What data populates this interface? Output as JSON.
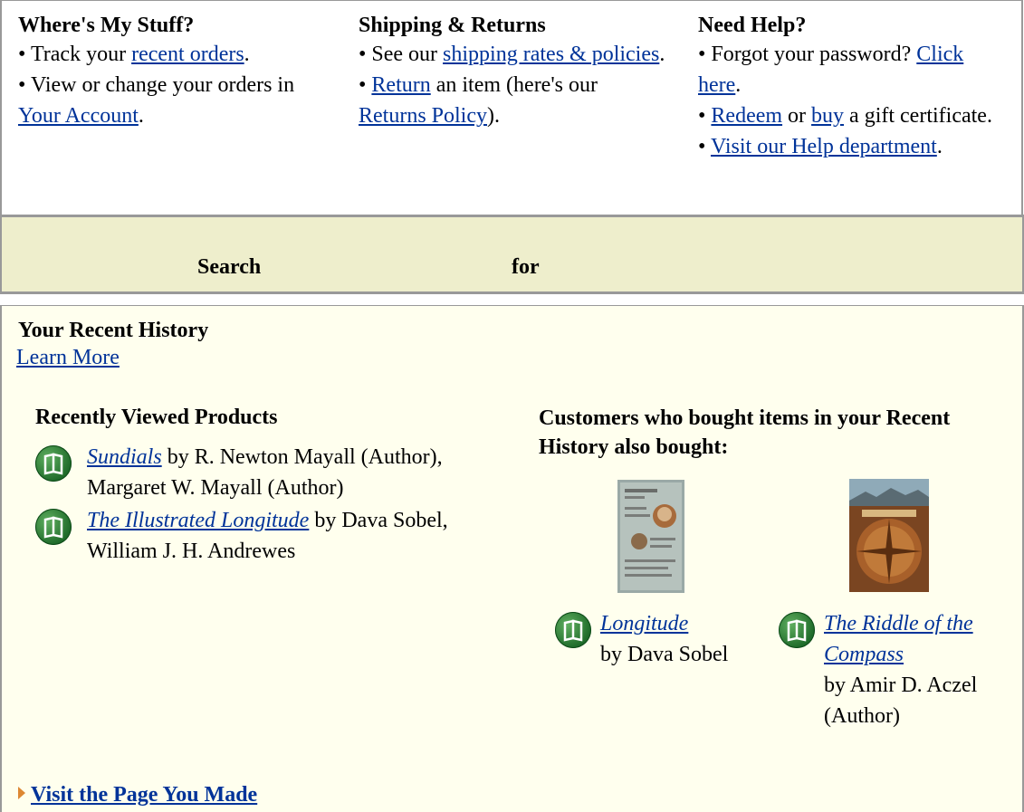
{
  "help": {
    "col1": {
      "title": "Where's My Stuff?",
      "l1_pre": "• Track your ",
      "l1_link": "recent orders",
      "l1_post": ".",
      "l2_pre": "• View or change your orders in ",
      "l2_link": "Your Account",
      "l2_post": "."
    },
    "col2": {
      "title": "Shipping & Returns",
      "l1_pre": "• See our ",
      "l1_link": "shipping rates & policies",
      "l1_post": ".",
      "l2_pre": "• ",
      "l2_link": "Return",
      "l2_mid": " an item (here's our ",
      "l2_link2": "Returns Policy",
      "l2_post": ")."
    },
    "col3": {
      "title": "Need Help?",
      "l1_pre": "• Forgot your password? ",
      "l1_link": "Click here",
      "l1_post": ".",
      "l2_pre": "• ",
      "l2_link": "Redeem",
      "l2_mid": " or ",
      "l2_link2": "buy",
      "l2_post": " a gift certificate.",
      "l3_pre": "• ",
      "l3_link": "Visit our Help department",
      "l3_post": "."
    }
  },
  "search": {
    "label": "Search",
    "for_label": "for"
  },
  "history": {
    "title": "Your Recent History",
    "learn_more": "Learn More",
    "recently_viewed": {
      "title": "Recently Viewed Products",
      "items": [
        {
          "title": "Sundials",
          "byline": " by R. Newton Mayall (Author), Margaret W. Mayall (Author)"
        },
        {
          "title": "The Illustrated Longitude",
          "byline": " by Dava Sobel, William J. H. Andrewes"
        }
      ]
    },
    "also_bought": {
      "title": "Customers who bought items in your Recent History also bought:",
      "items": [
        {
          "title": "Longitude",
          "byline": "by Dava Sobel"
        },
        {
          "title": "The Riddle of the Compass",
          "byline": "by Amir D. Aczel (Author)"
        }
      ]
    },
    "visit_page": "Visit the Page You Made"
  }
}
